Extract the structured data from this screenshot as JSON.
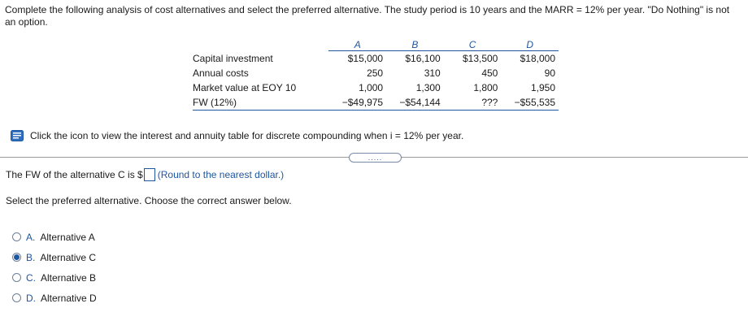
{
  "problem": {
    "text": "Complete the following analysis of cost alternatives and select the preferred alternative. The study period is 10 years and the MARR = 12% per year. \"Do Nothing\" is not an option."
  },
  "table": {
    "columns": [
      "A",
      "B",
      "C",
      "D"
    ],
    "rows": [
      {
        "label": "Capital investment",
        "values": [
          "$15,000",
          "$16,100",
          "$13,500",
          "$18,000"
        ]
      },
      {
        "label": "Annual costs",
        "values": [
          "250",
          "310",
          "450",
          "90"
        ]
      },
      {
        "label": "Market value at EOY 10",
        "values": [
          "1,000",
          "1,300",
          "1,800",
          "1,950"
        ]
      },
      {
        "label": "FW (12%)",
        "values": [
          "−$49,975",
          "−$54,144",
          "???",
          "−$55,535"
        ]
      }
    ]
  },
  "interest_table_link": {
    "text": "Click the icon to view the interest and annuity table for discrete compounding when i = 12% per year."
  },
  "expand_button": {
    "label": "....."
  },
  "fw_question": {
    "prefix": "The FW of the alternative C is $",
    "input_value": "",
    "hint": "(Round to the nearest dollar.)"
  },
  "select_prompt": "Select the preferred alternative. Choose the correct answer below.",
  "options": [
    {
      "letter": "A.",
      "label": "Alternative A",
      "selected": false
    },
    {
      "letter": "B.",
      "label": "Alternative C",
      "selected": true
    },
    {
      "letter": "C.",
      "label": "Alternative B",
      "selected": false
    },
    {
      "letter": "D.",
      "label": "Alternative D",
      "selected": false
    }
  ],
  "colors": {
    "accent": "#1e56a0",
    "divider": "#9a9a9a"
  },
  "icons": {
    "table_link": "book-icon",
    "radio": "radio-button"
  }
}
